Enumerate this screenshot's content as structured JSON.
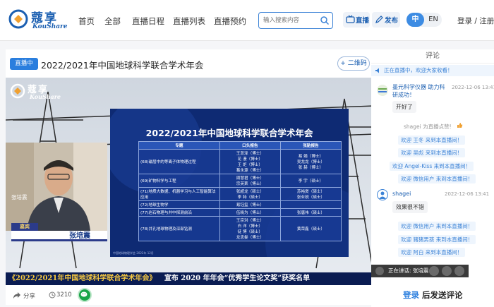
{
  "site": {
    "logo_cn": "蔻享",
    "logo_en": "KouShare"
  },
  "nav": {
    "items": [
      "首页",
      "全部",
      "直播日程",
      "直播列表",
      "直播预约"
    ],
    "search_placeholder": "输入搜索内容",
    "live_btn": "直播",
    "publish_btn": "发布",
    "lang_zh": "中",
    "lang_en": "EN",
    "auth": "登录 / 注册"
  },
  "main": {
    "badge": "直播中",
    "title": "2022/2021年中国地球科学联合学术年会",
    "qr_btn": "+ 二维码",
    "speaker_label": "张培震",
    "guest_tag": "嘉宾",
    "guest_name": "张培震",
    "slide": {
      "title": "2022/2021年中国地球科学联合学术年会",
      "headers": [
        "专题",
        "口头报告",
        "张贴报告"
      ],
      "rows": [
        {
          "topic": "(68)磁层中的等离子体物理过程",
          "oral": "王沥泽（博士）\n花 漫（博士）\n王 炬（博士）\n葛永源（博士）",
          "poster": "易 娟（博士）\n吴龙龙（博士）\n张 赫（博士）"
        },
        {
          "topic": "(69)矿物科学与工程",
          "oral": "周慧君（博士）\n宗英莱（博士）",
          "poster": "李 宇（硕士）"
        },
        {
          "topic": "(71)地质大数据、机器学习与人工智能算法应用",
          "oral": "张超龙（硕士）\n李 特（硕士）",
          "poster": "苏裕煲（硕士）\n张业锐（硕士）"
        },
        {
          "topic": "(72)地球生物学",
          "oral": "易钰玺（博士）",
          "poster": ""
        },
        {
          "topic": "(77)岩石物理与井中探测前沿",
          "oral": "伍晓为（博士）",
          "poster": "张唐伟（硕士）"
        },
        {
          "topic": "(78)井孔地球物理及深部钻测",
          "oral": "王宗洪（博士）\n白 洋（博士）\n徒 博（硕士）\n龙忠娄（博士）",
          "poster": "黄荣鑫（硕士）"
        }
      ],
      "footer": "中国地球物理学会 2022年 12月"
    },
    "ticker_title": "《2022/2021年中国地球科学联合学术年会》",
    "ticker_text": "宣布 2020 年年会“优秀学生论文奖”获奖名单",
    "share_label": "分享",
    "views": "3210"
  },
  "comments": {
    "header": "评论",
    "notice": "正在直播中，欢迎大家收看！",
    "items": [
      {
        "user": "墨元科学仪器 助力科研成功！",
        "time": "2022-12-06 13:41",
        "msg": "开好了"
      },
      {
        "user": "shagei",
        "time": "2022-12-06 13:41",
        "msg": "效果很不错"
      }
    ],
    "like_text": "shagei 为直播点赞!",
    "welcomes_1": [
      "欢迎 王冬 来到本直播间！",
      "欢迎 吴彪 来到本直播间！",
      "欢迎 Angel-Kiss 来到本直播间！",
      "欢迎 微信用户 来到本直播间！"
    ],
    "welcomes_2": [
      "欢迎 微信用户 来到本直播间！",
      "欢迎 猪猪男孩 来到本直播间！",
      "欢迎 阿白 来到本直播间！"
    ],
    "now_talking": "正在讲话: 张培震:",
    "login": "登录",
    "post_comment": "后发送评论"
  },
  "colors": {
    "accent": "#2a7ede",
    "brand": "#1b5fb1",
    "slide_bg": "#0e2a73",
    "ticker_text": "#f5c842"
  }
}
